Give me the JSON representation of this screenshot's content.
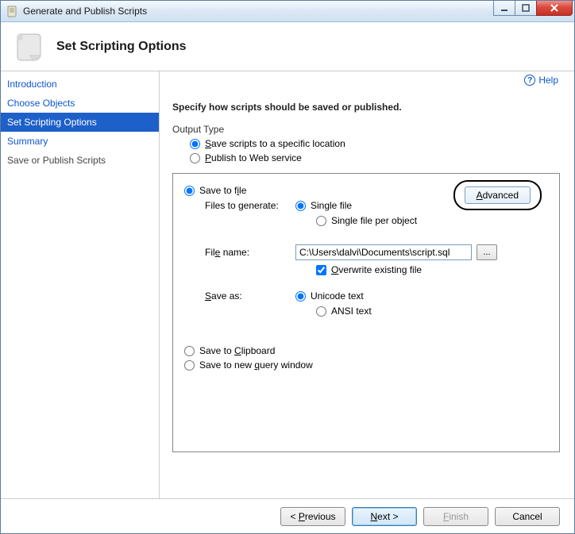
{
  "window": {
    "title": "Generate and Publish Scripts"
  },
  "header": {
    "title": "Set Scripting Options"
  },
  "sidebar": {
    "items": [
      {
        "label": "Introduction"
      },
      {
        "label": "Choose Objects"
      },
      {
        "label": "Set Scripting Options"
      },
      {
        "label": "Summary"
      },
      {
        "label": "Save or Publish Scripts"
      }
    ]
  },
  "help": {
    "label": "Help"
  },
  "content": {
    "heading": "Specify how scripts should be saved or published.",
    "output_type_label": "Output Type",
    "save_location": {
      "prefix": "S",
      "suffix": "ave scripts to a specific location"
    },
    "publish_web": {
      "prefix": "P",
      "suffix": "ublish to Web service"
    },
    "save_to_file": {
      "pre": "Save to f",
      "u": "i",
      "post": "le"
    },
    "advanced": {
      "u": "A",
      "post": "dvanced"
    },
    "files_to_generate": "Files to generate:",
    "single_file": "Single file",
    "single_per_obj": "Single file per object",
    "file_name": {
      "pre": "Fil",
      "u": "e",
      "post": " name:"
    },
    "file_path": "C:\\Users\\dalvi\\Documents\\script.sql",
    "browse": "...",
    "overwrite": {
      "u": "O",
      "post": "verwrite existing file"
    },
    "save_as": {
      "u": "S",
      "post": "ave as:"
    },
    "unicode": "Unicode text",
    "ansi": "ANSI text",
    "save_clip": {
      "pre": "Save to ",
      "u": "C",
      "post": "lipboard"
    },
    "save_query": {
      "pre": "Save to new ",
      "u": "q",
      "post": "uery window"
    }
  },
  "footer": {
    "previous": {
      "pre": "< ",
      "u": "P",
      "post": "revious"
    },
    "next": {
      "u": "N",
      "post": "ext >"
    },
    "finish": {
      "u": "F",
      "post": "inish"
    },
    "cancel": "Cancel"
  }
}
